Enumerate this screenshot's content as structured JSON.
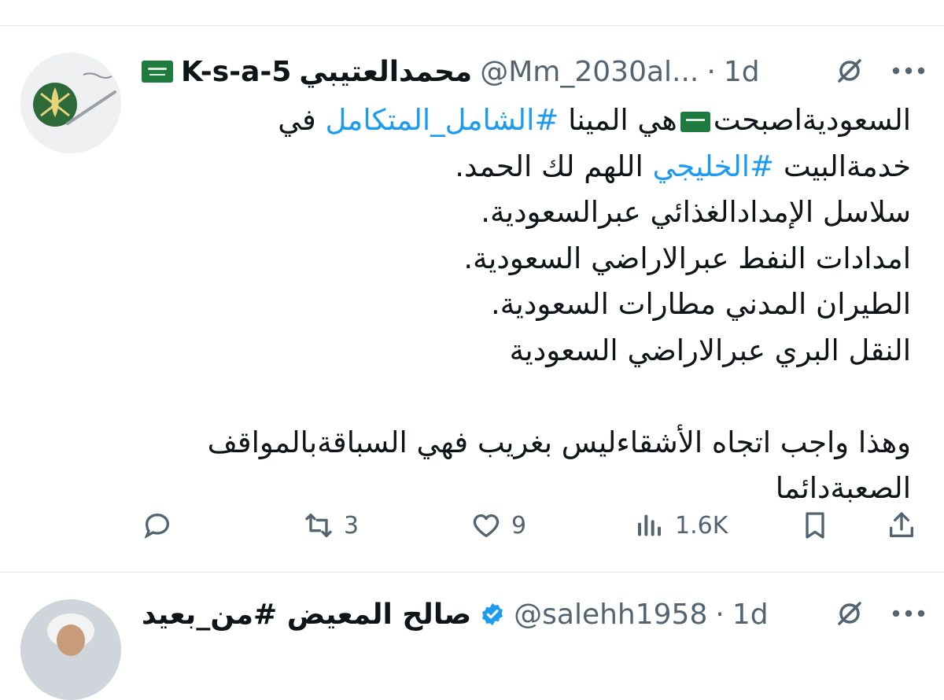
{
  "tweet": {
    "author_name": "محمدالعتيبي",
    "author_tag": "K-s-a-5",
    "handle": "@Mm_2030al...",
    "separator": "·",
    "time": "1d",
    "lines": [
      {
        "segments": [
          {
            "text": "السعوديةاصبحت",
            "hashtag": false
          },
          {
            "flag": true
          },
          {
            "text": "هي المينا ",
            "hashtag": false
          },
          {
            "text": "#الشامل_المتكامل",
            "hashtag": true
          },
          {
            "text": " في",
            "hashtag": false
          }
        ]
      },
      {
        "segments": [
          {
            "text": "خدمةالبيت ",
            "hashtag": false
          },
          {
            "text": "#الخليجي",
            "hashtag": true
          },
          {
            "text": " اللهم لك الحمد.",
            "hashtag": false
          }
        ]
      },
      {
        "segments": [
          {
            "text": "سلاسل الإمدادالغذائي عبرالسعودية.",
            "hashtag": false
          }
        ]
      },
      {
        "segments": [
          {
            "text": "امدادات النفط عبرالاراضي السعودية.",
            "hashtag": false
          }
        ]
      },
      {
        "segments": [
          {
            "text": "الطيران المدني مطارات السعودية.",
            "hashtag": false
          }
        ]
      },
      {
        "segments": [
          {
            "text": "النقل البري عبرالاراضي السعودية",
            "hashtag": false
          }
        ]
      },
      {
        "segments": [
          {
            "text": "",
            "hashtag": false
          }
        ]
      },
      {
        "segments": [
          {
            "text": "وهذا واجب اتجاه الأشقاءليس بغريب فهي السباقةبالمواقف",
            "hashtag": false
          }
        ]
      },
      {
        "segments": [
          {
            "text": "الصعبةدائما",
            "hashtag": false
          }
        ]
      }
    ],
    "actions": {
      "reply_count": "",
      "retweet_count": "3",
      "like_count": "9",
      "views_count": "1.6K"
    }
  },
  "next_tweet": {
    "author_name": "صالح المعيض #من_بعيد",
    "handle": "@salehh1958",
    "separator": "·",
    "time": "1d"
  },
  "colors": {
    "text": "#0f1419",
    "secondary": "#536471",
    "hashtag": "#1d9bf0",
    "verified": "#1d9bf0",
    "flag": "#1f7a3d",
    "divider": "#e6ecf0"
  },
  "icons": [
    "grok-slash-icon",
    "more-icon",
    "reply-icon",
    "retweet-icon",
    "like-icon",
    "views-icon",
    "bookmark-icon",
    "share-icon",
    "verified-icon"
  ]
}
